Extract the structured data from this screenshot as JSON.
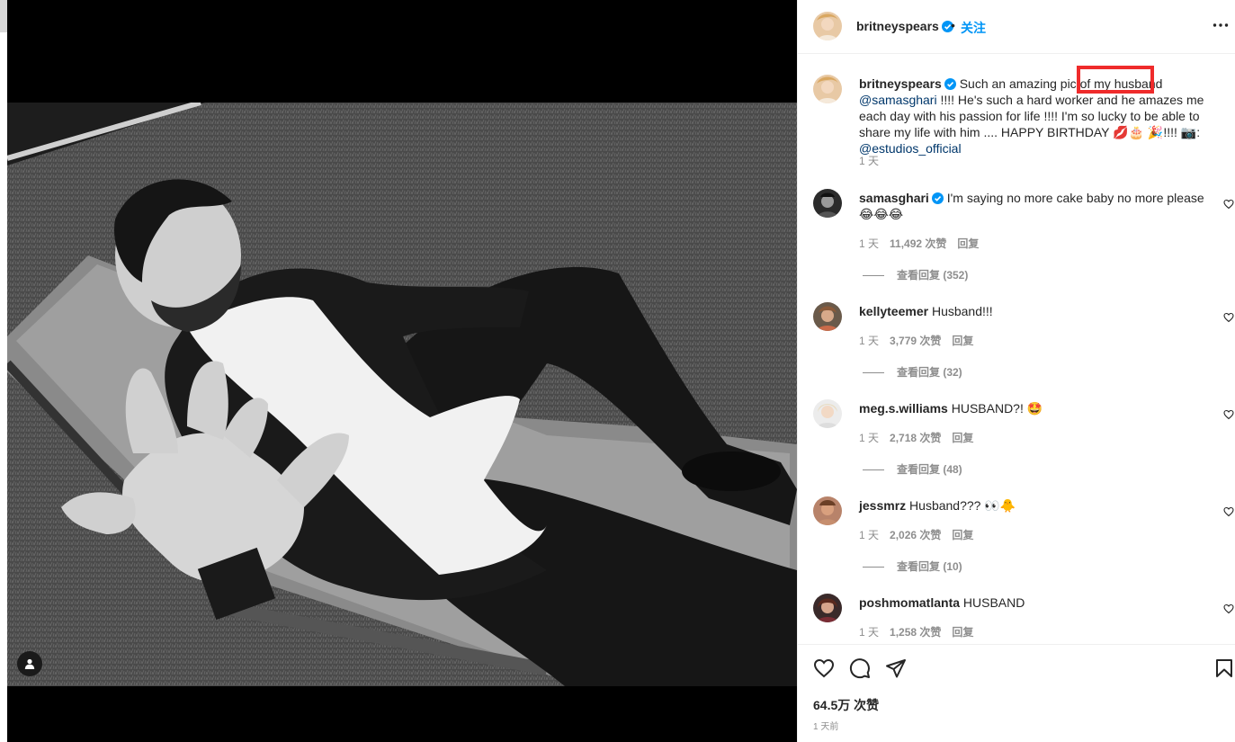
{
  "post": {
    "username": "britneyspears",
    "follow_label": "关注",
    "header_dot": "•",
    "caption": {
      "username": "britneyspears",
      "text_part1": "Such an amazing pic of ",
      "highlighted": "my husband",
      "mention1": "@samasghari",
      "text_part2": " !!!! He's such a hard worker and he amazes me each day with his passion for life !!!! I'm so lucky to be able to share my life with him .... HAPPY BIRTHDAY 💋🎂 🎉!!!! 📷: ",
      "mention2": "@estudios_official",
      "time": "1 天"
    },
    "likes": "64.5万 次赞",
    "time_ago": "1 天前"
  },
  "comments": [
    {
      "username": "samasghari",
      "verified": true,
      "text": "I'm saying no more cake baby no more please 😂😂😂",
      "time": "1 天",
      "likes": "11,492 次赞",
      "reply": "回复",
      "view_replies": "查看回复 (352)"
    },
    {
      "username": "kellyteemer",
      "verified": false,
      "text": "Husband!!!",
      "time": "1 天",
      "likes": "3,779 次赞",
      "reply": "回复",
      "view_replies": "查看回复 (32)"
    },
    {
      "username": "meg.s.williams",
      "verified": false,
      "text": "HUSBAND?! 🤩",
      "time": "1 天",
      "likes": "2,718 次赞",
      "reply": "回复",
      "view_replies": "查看回复 (48)"
    },
    {
      "username": "jessmrz",
      "verified": false,
      "text": "Husband??? 👀🐥",
      "time": "1 天",
      "likes": "2,026 次赞",
      "reply": "回复",
      "view_replies": "查看回复 (10)"
    },
    {
      "username": "poshmomatlanta",
      "verified": false,
      "text": "HUSBAND",
      "time": "1 天",
      "likes": "1,258 次赞",
      "reply": "回复",
      "view_replies": ""
    }
  ],
  "colors": {
    "accent": "#0095f6",
    "mention": "#00376b",
    "highlight": "#ef2b2b",
    "muted": "#8e8e8e"
  },
  "icons": [
    "verified-icon",
    "more-icon",
    "heart-icon",
    "comment-icon",
    "share-icon",
    "bookmark-icon",
    "user-tag-icon"
  ]
}
